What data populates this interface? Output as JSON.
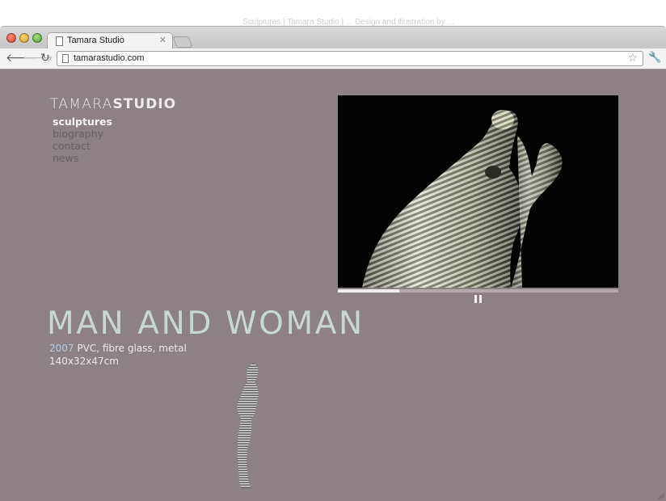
{
  "browser": {
    "os_title": "Sculptures | Tamara Studio | ... Design and illustration by ...",
    "tab_title": "Tamara Studio",
    "url": "tamarastudio.com"
  },
  "site": {
    "logo_light": "TAMARA",
    "logo_bold": "STUDIO",
    "nav": [
      "sculptures",
      "biography",
      "contact",
      "news"
    ],
    "active_nav": "sculptures"
  },
  "video": {
    "progress": 0.22
  },
  "sculpture": {
    "title": "MAN AND WOMAN",
    "year": "2007",
    "materials": "PVC, fibre glass, metal",
    "dimensions": "140x32x47cm"
  },
  "icons": {
    "tab": "page-icon",
    "tab_close": "close-icon",
    "back": "back-arrow-icon",
    "forward": "forward-arrow-icon",
    "reload": "reload-icon",
    "bookmark": "star-icon",
    "settings": "wrench-icon",
    "pause": "pause-icon"
  },
  "colors": {
    "page_background": "#8c8184",
    "title": "#c8d6d4",
    "year": "#b6cbe0",
    "nav_active": "#f4f3f3",
    "nav_inactive": "#6a6264"
  }
}
